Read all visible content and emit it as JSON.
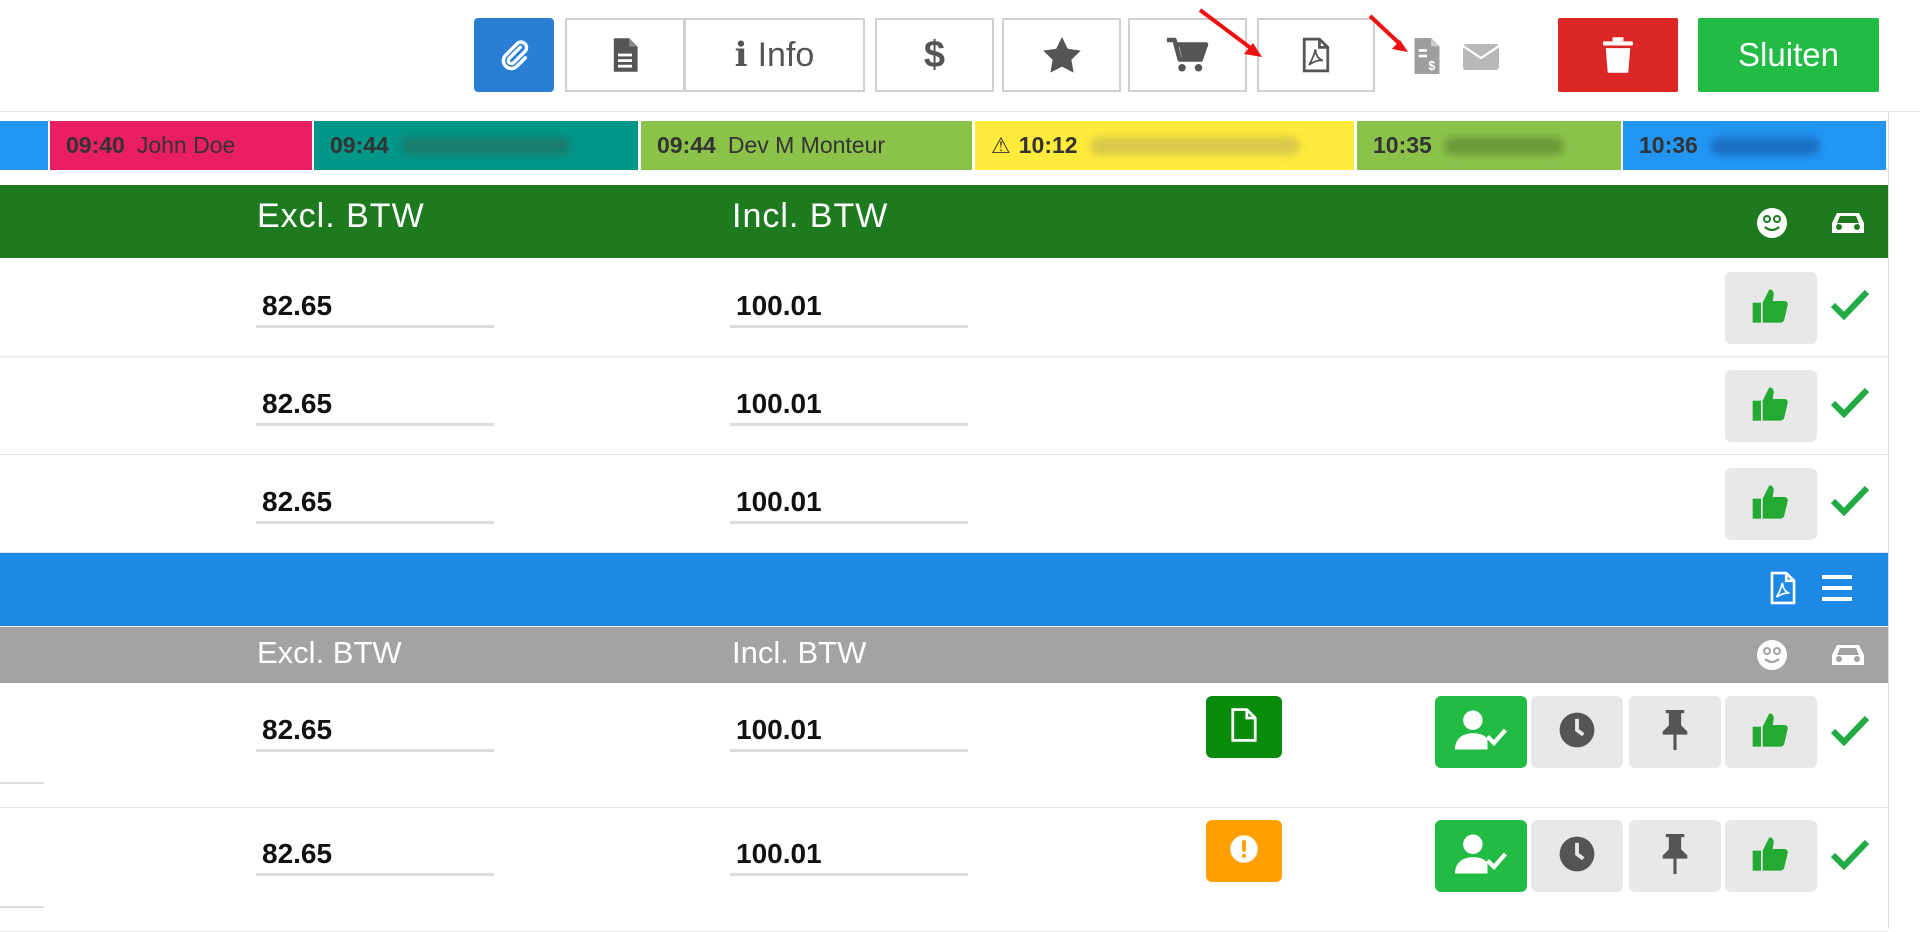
{
  "toolbar": {
    "info_label": "Info",
    "close_label": "Sluiten",
    "icons": [
      "paperclip-icon",
      "document-icon",
      "info-icon",
      "dollar-icon",
      "star-icon",
      "cart-icon",
      "pdf-icon",
      "invoice-icon",
      "mail-icon",
      "trash-icon"
    ]
  },
  "timeline": [
    {
      "time": "09:40",
      "name": "John Doe",
      "color": "#e91e63"
    },
    {
      "time": "09:44",
      "name": "",
      "color": "#009688"
    },
    {
      "time": "09:44",
      "name": "Dev M Monteur",
      "color": "#8bc34a"
    },
    {
      "time": "10:12",
      "name": "",
      "color": "#ffeb3b"
    },
    {
      "time": "10:35",
      "name": "",
      "color": "#8bc34a"
    },
    {
      "time": "10:36",
      "name": "",
      "color": "#2196f3"
    }
  ],
  "section1": {
    "header": {
      "excl": "Excl. BTW",
      "incl": "Incl. BTW",
      "color": "#1e7a1e"
    },
    "rows": [
      {
        "excl": "82.65",
        "incl": "100.01"
      },
      {
        "excl": "82.65",
        "incl": "100.01"
      },
      {
        "excl": "82.65",
        "incl": "100.01"
      }
    ]
  },
  "section2": {
    "bar_color": "#1e88e5",
    "header": {
      "excl": "Excl. BTW",
      "incl": "Incl. BTW",
      "color": "#a3a3a3"
    },
    "rows": [
      {
        "excl": "82.65",
        "incl": "100.01",
        "status": "document",
        "status_color": "#0a8a0a"
      },
      {
        "excl": "82.65",
        "incl": "100.01",
        "status": "warning",
        "status_color": "#ffa000"
      }
    ]
  }
}
